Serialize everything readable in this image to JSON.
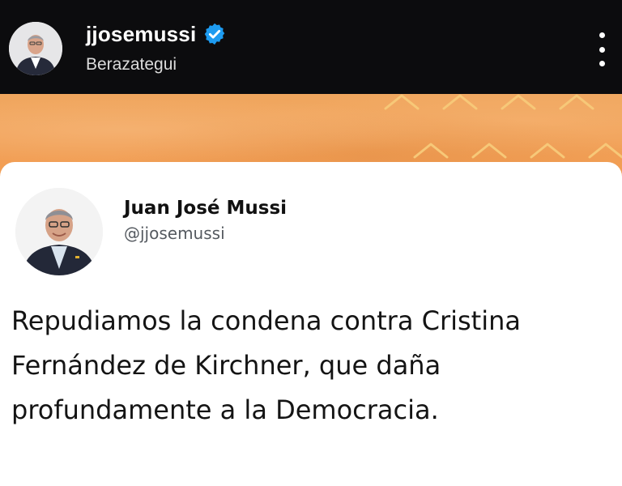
{
  "header": {
    "username": "jjosemussi",
    "location": "Berazategui",
    "verified_color": "#1d9bf0",
    "avatar_icon": "profile-photo",
    "more_icon": "vertical-dots-icon"
  },
  "banner": {
    "color": "#f29c52"
  },
  "tweet": {
    "author_name": "Juan José Mussi",
    "author_handle": "@jjosemussi",
    "text": "Repudiamos la condena contra Cristina\nFernández de Kirchner, que daña\nprofundamente a la Democracia."
  }
}
